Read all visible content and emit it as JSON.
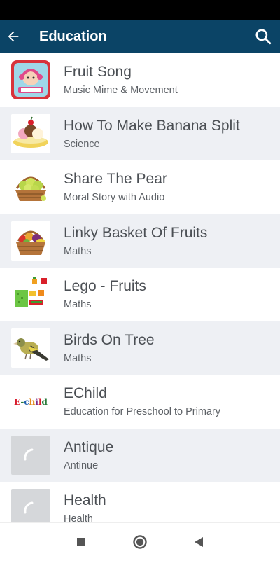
{
  "app_bar": {
    "title": "Education",
    "back_icon": "arrow-left-icon",
    "search_icon": "search-icon",
    "color": "#0b4466"
  },
  "items": [
    {
      "title": "Fruit Song",
      "subtitle": "Music Mime & Movement",
      "icon": "fruit-song-thumbnail"
    },
    {
      "title": "How To Make Banana Split",
      "subtitle": "Science",
      "icon": "banana-split-thumbnail"
    },
    {
      "title": "Share The Pear",
      "subtitle": "Moral Story with Audio",
      "icon": "pear-basket-thumbnail"
    },
    {
      "title": "Linky Basket Of Fruits",
      "subtitle": "Maths",
      "icon": "fruit-basket-thumbnail"
    },
    {
      "title": "Lego - Fruits",
      "subtitle": "Maths",
      "icon": "lego-fruits-thumbnail"
    },
    {
      "title": "Birds On Tree",
      "subtitle": "Maths",
      "icon": "bird-thumbnail"
    },
    {
      "title": "EChild",
      "subtitle": "Education for Preschool to Primary",
      "icon": "echild-logo",
      "logo_text": "E-child"
    },
    {
      "title": "Antique",
      "subtitle": "Antinue",
      "icon": "loading-placeholder"
    },
    {
      "title": "Health",
      "subtitle": "Health",
      "icon": "loading-placeholder"
    }
  ],
  "nav_bar": {
    "recents_icon": "square-icon",
    "home_icon": "circle-icon",
    "back_icon": "triangle-back-icon"
  }
}
